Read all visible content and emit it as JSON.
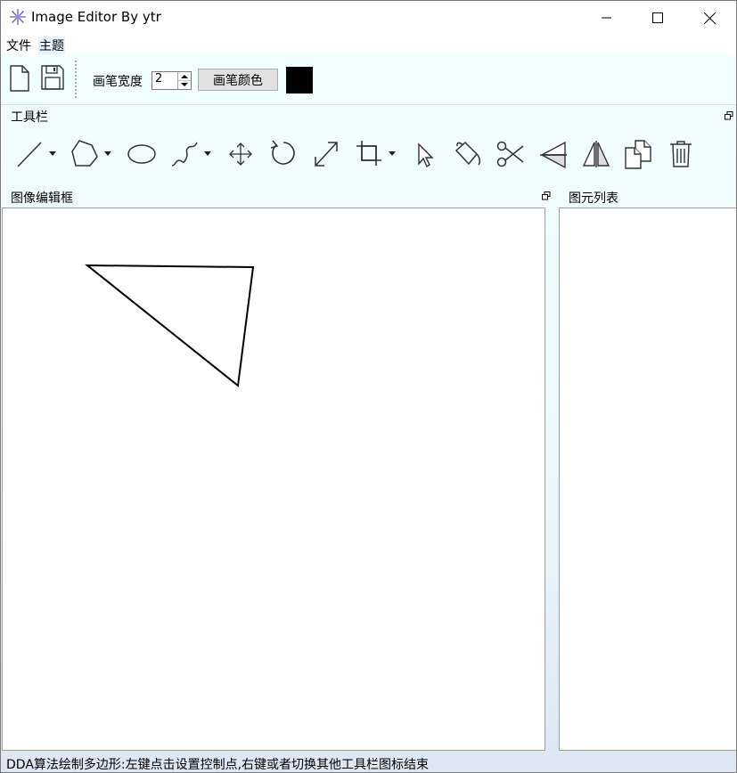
{
  "window": {
    "title": "Image Editor By ytr",
    "controls": [
      "minimize",
      "maximize",
      "close"
    ]
  },
  "menu": {
    "items": [
      {
        "label": "文件"
      },
      {
        "label": "主题"
      }
    ]
  },
  "pen_toolbar": {
    "pen_width_label": "画笔宽度",
    "pen_width_value": "2",
    "pen_color_button": "画笔颜色",
    "pen_color": "#000000",
    "icons": [
      "new-file-icon",
      "save-icon"
    ]
  },
  "toolbox": {
    "title": "工具栏",
    "tools": [
      {
        "name": "line-tool-icon",
        "dropdown": true
      },
      {
        "name": "polygon-tool-icon",
        "dropdown": true
      },
      {
        "name": "ellipse-tool-icon",
        "dropdown": false
      },
      {
        "name": "curve-tool-icon",
        "dropdown": true
      },
      {
        "name": "move-tool-icon",
        "dropdown": false
      },
      {
        "name": "rotate-tool-icon",
        "dropdown": false
      },
      {
        "name": "scale-tool-icon",
        "dropdown": false
      },
      {
        "name": "crop-tool-icon",
        "dropdown": true
      },
      {
        "name": "select-pointer-icon",
        "dropdown": false
      },
      {
        "name": "fill-bucket-icon",
        "dropdown": false
      },
      {
        "name": "scissors-icon",
        "dropdown": false
      },
      {
        "name": "flip-horizontal-icon",
        "dropdown": false
      },
      {
        "name": "mirror-vertical-icon",
        "dropdown": false
      },
      {
        "name": "copy-icon",
        "dropdown": false
      },
      {
        "name": "trash-icon",
        "dropdown": false
      }
    ]
  },
  "editor": {
    "title": "图像编辑框"
  },
  "primitives": {
    "title": "图元列表",
    "items": []
  },
  "status_bar": {
    "text": "DDA算法绘制多边形:左键点击设置控制点,右键或者切换其他工具栏图标结束"
  },
  "colors": {
    "panel_bg": "#f1ffff",
    "gradient_bottom": "#dde6f3",
    "stroke": "#000000"
  }
}
